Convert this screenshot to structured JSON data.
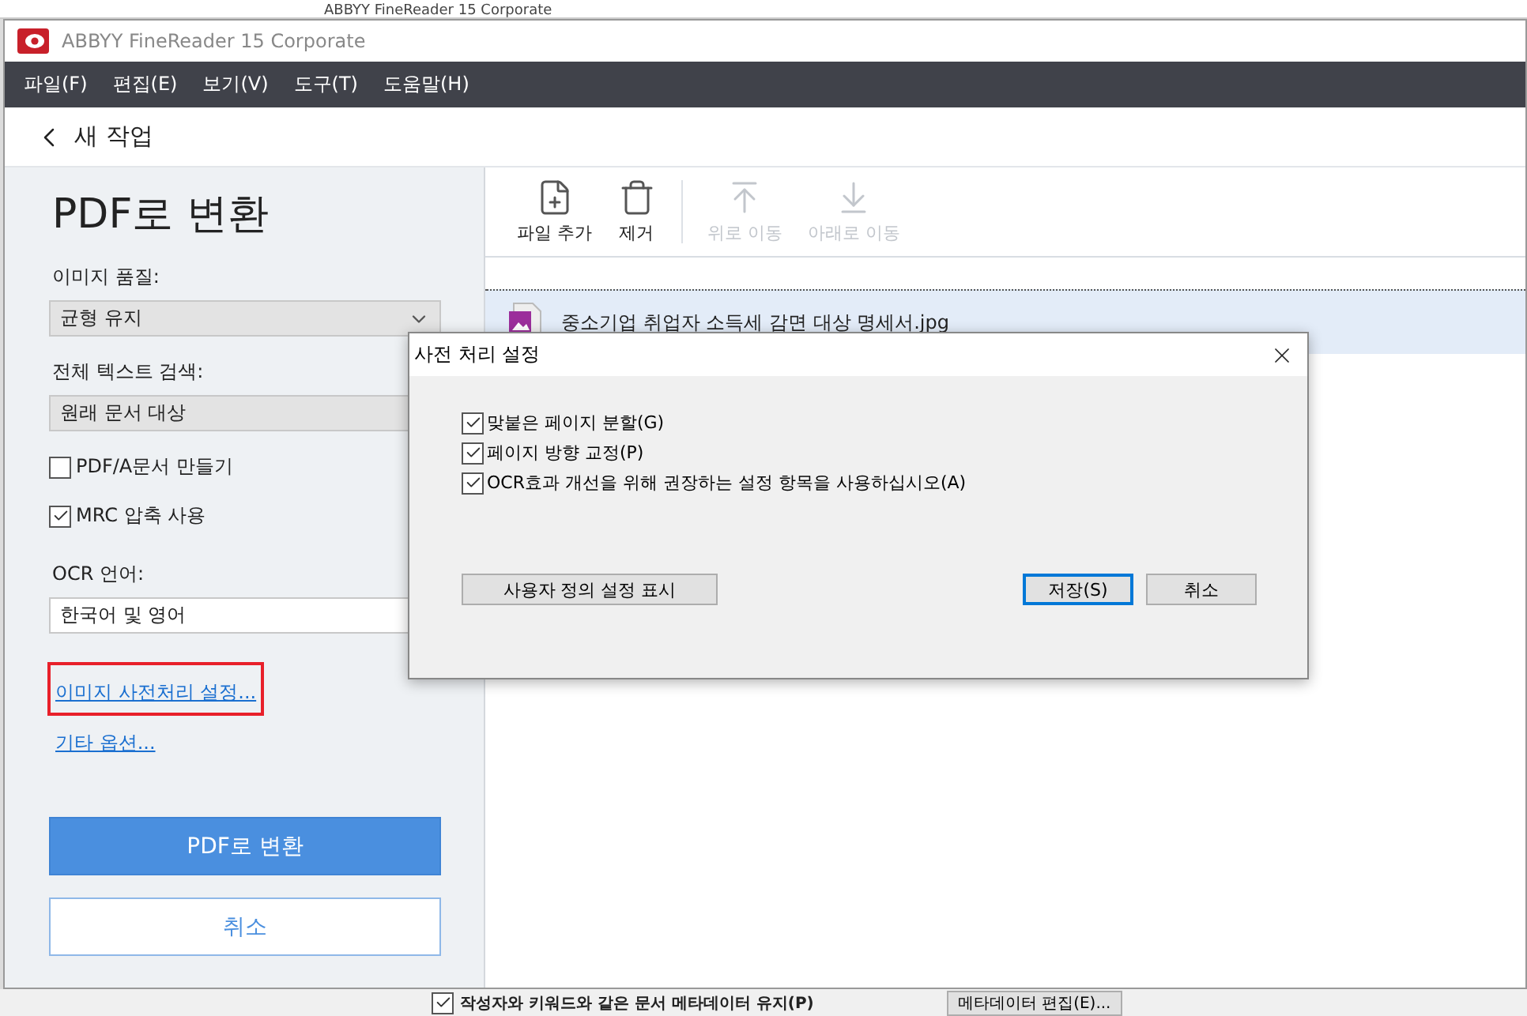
{
  "background_window": {
    "title": "ABBYY FineReader 15 Corporate",
    "metadata_checkbox": {
      "label": "작성자와 키워드와 같은 문서 메타데이터 유지(P)",
      "checked": true
    },
    "metadata_button": "메타데이터 편집(E)..."
  },
  "window": {
    "title": "ABBYY FineReader 15 Corporate"
  },
  "menu": [
    "파일(F)",
    "편집(E)",
    "보기(V)",
    "도구(T)",
    "도움말(H)"
  ],
  "nav": {
    "back_label": "새 작업"
  },
  "left_panel": {
    "title": "PDF로 변환",
    "image_quality": {
      "label": "이미지 품질:",
      "value": "균형 유지"
    },
    "text_search": {
      "label": "전체 텍스트 검색:",
      "value": "원래 문서 대상"
    },
    "options": [
      {
        "label": "PDF/A문서 만들기",
        "checked": false
      },
      {
        "label": "MRC 압축 사용",
        "checked": true
      }
    ],
    "ocr_language": {
      "label": "OCR 언어:",
      "value": "한국어 및 영어"
    },
    "links": [
      {
        "label": "이미지 사전처리 설정...",
        "highlighted": true
      },
      {
        "label": "기타 옵션...",
        "highlighted": false
      }
    ],
    "convert_button": "PDF로 변환",
    "cancel_button": "취소"
  },
  "toolbar": [
    {
      "kind": "add",
      "label": "파일 추가",
      "disabled": false
    },
    {
      "kind": "remove",
      "label": "제거",
      "disabled": false
    },
    {
      "kind": "up",
      "label": "위로 이동",
      "disabled": true
    },
    {
      "kind": "down",
      "label": "아래로 이동",
      "disabled": true
    }
  ],
  "files": [
    {
      "name": "중소기업 취업자 소득세 감면 대상 명세서.jpg",
      "selected": true
    }
  ],
  "dialog": {
    "title": "사전 처리 설정",
    "options": [
      {
        "label": "맞붙은 페이지 분할(G)",
        "checked": true
      },
      {
        "label": "페이지 방향 교정(P)",
        "checked": true
      },
      {
        "label": "OCR효과 개선을 위해 권장하는 설정 항목을 사용하십시오(A)",
        "checked": true
      }
    ],
    "custom_button": "사용자 정의 설정 표시",
    "save_button": "저장(S)",
    "cancel_button": "취소"
  }
}
